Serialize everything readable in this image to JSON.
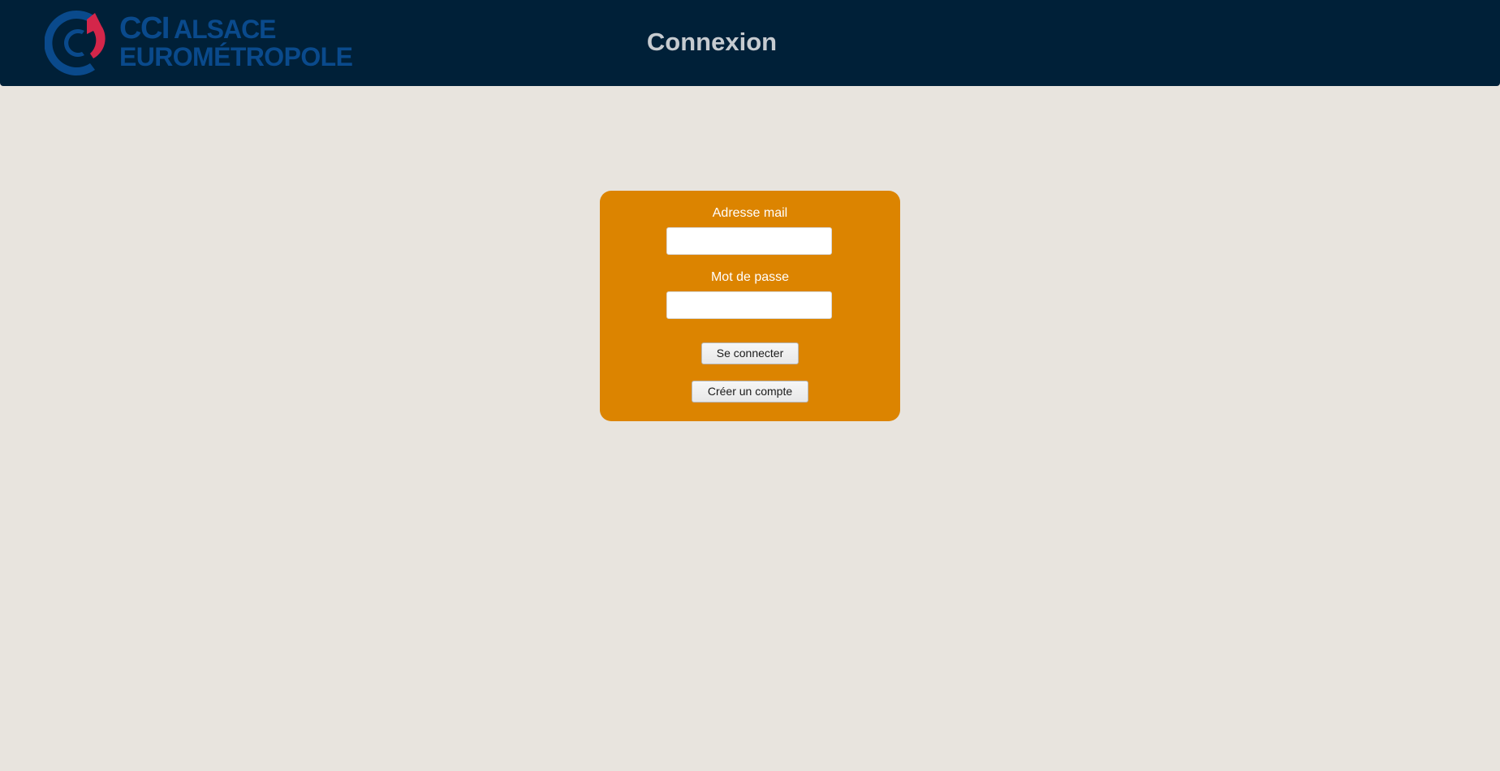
{
  "header": {
    "logo": {
      "brand_short": "CCI",
      "brand_line1": "ALSACE",
      "brand_line2": "EUROMÉTROPOLE",
      "colors": {
        "blue": "#0a4a8c",
        "red": "#d4264a"
      }
    },
    "title": "Connexion",
    "background": "#002038"
  },
  "login_form": {
    "background": "#dc8400",
    "email": {
      "label": "Adresse mail",
      "value": "",
      "placeholder": ""
    },
    "password": {
      "label": "Mot de passe",
      "value": "",
      "placeholder": ""
    },
    "submit_label": "Se connecter",
    "create_account_label": "Créer un compte"
  },
  "page": {
    "background": "#e8e4de"
  }
}
